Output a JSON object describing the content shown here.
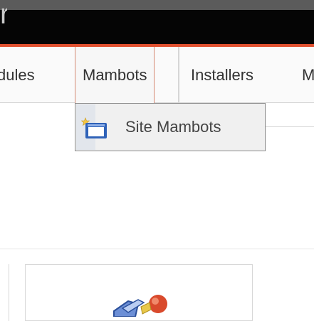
{
  "window": {
    "title_fragment": "r"
  },
  "menubar": {
    "items": [
      {
        "label": "dules"
      },
      {
        "label": "Mambots"
      },
      {
        "label": "Installers"
      },
      {
        "label": "M"
      }
    ],
    "active_item": "Mambots"
  },
  "dropdown": {
    "items": [
      {
        "label": "Site Mambots",
        "icon": "site-window-icon"
      }
    ]
  },
  "content": {
    "icon": "mambot-plugin-icon"
  },
  "colors": {
    "topbar": "#050505",
    "accent": "#e0502f",
    "menubar_bg": "#fafafa"
  }
}
